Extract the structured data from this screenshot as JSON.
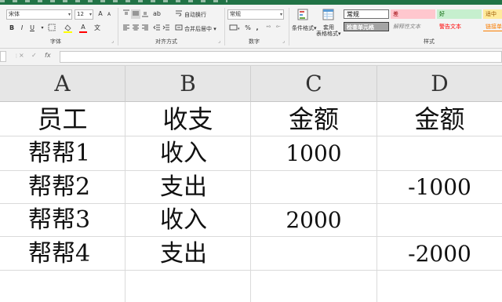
{
  "ribbon": {
    "font_name": "宋体",
    "font_size": "12",
    "bold": "B",
    "italic": "I",
    "underline": "U",
    "wrap_text": "自动换行",
    "merge_center": "合并后居中",
    "number_format": "常规",
    "percent": "%",
    "comma": ",",
    "conditional_format": "条件格式",
    "format_as_table_1": "套用",
    "format_as_table_2": "表格格式",
    "groups": {
      "font": "字体",
      "alignment": "对齐方式",
      "number": "数字",
      "styles": "样式"
    },
    "styles": {
      "normal": "常规",
      "bad": "差",
      "good": "好",
      "neutral": "适中",
      "check_cell": "检查单元格",
      "explanatory": "解释性文本",
      "warning": "警告文本",
      "linked_cell": "链接单"
    }
  },
  "formula_bar": {
    "cancel": "×",
    "enter": "✓",
    "fx": "fx",
    "value": ""
  },
  "sheet": {
    "columns": [
      "A",
      "B",
      "C",
      "D"
    ],
    "rows": [
      [
        "员工",
        "收支",
        "金额",
        "金额"
      ],
      [
        "帮帮1",
        "收入",
        "1000",
        ""
      ],
      [
        "帮帮2",
        "支出",
        "",
        "-1000"
      ],
      [
        "帮帮3",
        "收入",
        "2000",
        ""
      ],
      [
        "帮帮4",
        "支出",
        "",
        "-2000"
      ]
    ]
  },
  "colors": {
    "title_bar": "#217346",
    "ribbon_bg": "#f3f3f3",
    "header_bg": "#e6e6e6",
    "style_bad_bg": "#ffc7ce",
    "style_bad_fg": "#9c0006",
    "style_good_bg": "#c6efce",
    "style_good_fg": "#006100",
    "style_neutral_bg": "#ffeb9c",
    "style_neutral_fg": "#9c5700",
    "check_cell_bg": "#a5a5a5",
    "warning_fg": "#ff0000",
    "linked_fg": "#fa7d00"
  }
}
